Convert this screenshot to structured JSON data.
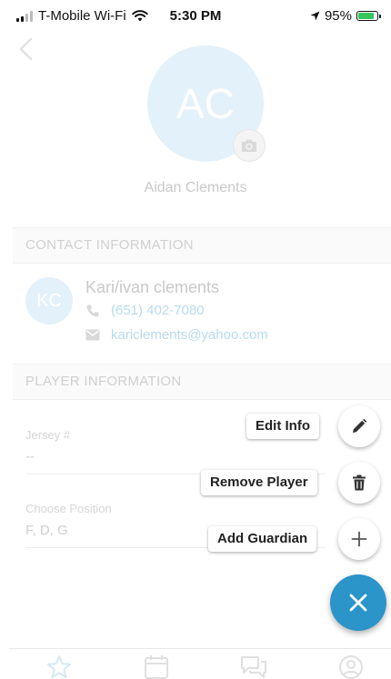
{
  "status_bar": {
    "carrier": "T-Mobile Wi-Fi",
    "time": "5:30 PM",
    "battery_percent": "95%",
    "battery_level": 0.95
  },
  "profile": {
    "initials": "AC",
    "name": "Aidan Clements"
  },
  "contact_section": {
    "header": "CONTACT INFORMATION",
    "guardian_initials": "KC",
    "guardian_name": "Kari/ivan clements",
    "phone": "(651) 402-7080",
    "email": "kariclements@yahoo.com"
  },
  "player_section": {
    "header": "PLAYER INFORMATION",
    "jersey_label": "Jersey #",
    "jersey_value": "--",
    "position_label": "Choose Position",
    "position_value": "F, D, G"
  },
  "speed_dial": {
    "edit_label": "Edit Info",
    "remove_label": "Remove Player",
    "add_label": "Add Guardian"
  },
  "tabs": [
    "star-icon",
    "calendar-icon",
    "chat-icon",
    "profile-icon"
  ],
  "colors": {
    "accent": "#2b94c8",
    "avatar_bg": "#e3f1fa",
    "link": "#b8dcf0"
  }
}
